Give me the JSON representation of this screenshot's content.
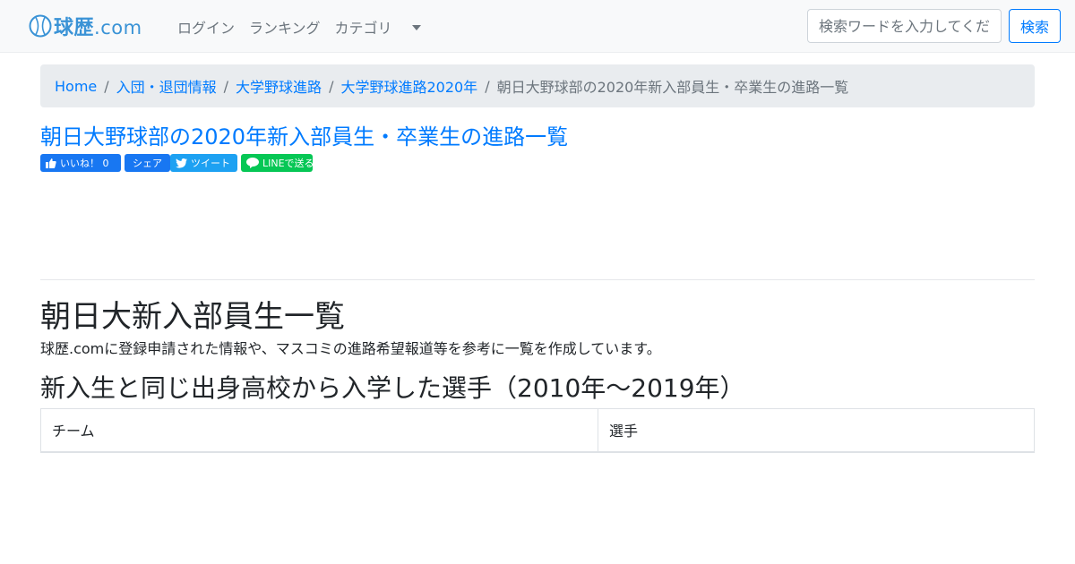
{
  "brand": {
    "name": "球歴",
    "suffix": ".com"
  },
  "nav": {
    "login": "ログイン",
    "ranking": "ランキング",
    "category": "カテゴリ"
  },
  "search": {
    "placeholder": "検索ワードを入力してください",
    "button": "検索"
  },
  "breadcrumb": [
    {
      "label": "Home"
    },
    {
      "label": "入団・退団情報"
    },
    {
      "label": "大学野球進路"
    },
    {
      "label": "大学野球進路2020年"
    },
    {
      "label": "朝日大野球部の2020年新入部員生・卒業生の進路一覧"
    }
  ],
  "page": {
    "title": "朝日大野球部の2020年新入部員生・卒業生の進路一覧"
  },
  "share": {
    "like": "いいね！ 0",
    "share": "シェア",
    "tweet": "ツイート",
    "line": "LINEで送る"
  },
  "section": {
    "heading": "朝日大新入部員生一覧",
    "description": "球歴.comに登録申請された情報や、マスコミの進路希望報道等を参考に一覧を作成しています。",
    "subheading": "新入生と同じ出身高校から入学した選手（2010年〜2019年）"
  },
  "table": {
    "columns": [
      "チーム",
      "選手"
    ]
  },
  "colors": {
    "link": "#007bff",
    "navbar": "#f8f9fa",
    "breadcrumb_bg": "#e9ecef",
    "facebook": "#1877f2",
    "twitter": "#1da1f2",
    "line": "#06c755"
  }
}
